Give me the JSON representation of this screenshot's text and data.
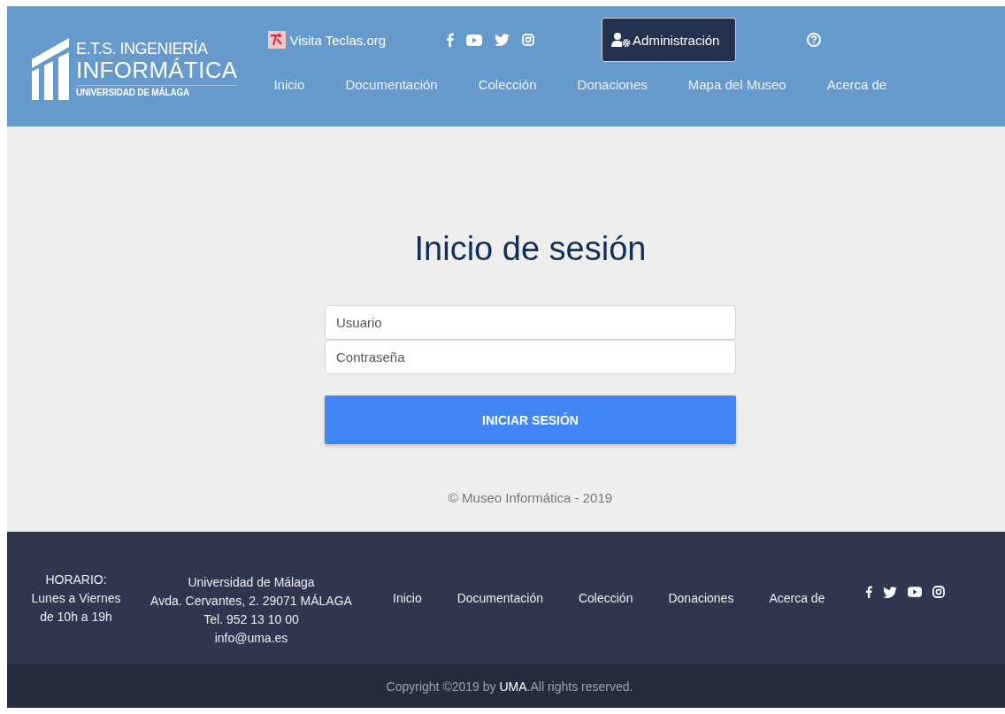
{
  "header": {
    "logo": {
      "line_1": "E.T.S. INGENIERÍA",
      "line_2": "INFORMÁTICA",
      "line_3": "UNIVERSIDAD DE MÁLAGA"
    },
    "teclas_link": "Visita Teclas.org",
    "social": [
      {
        "kind": "facebook"
      },
      {
        "kind": "youtube"
      },
      {
        "kind": "twitter"
      },
      {
        "kind": "instagram"
      }
    ],
    "admin_button": "Administración",
    "nav": [
      "Inicio",
      "Documentación",
      "Colección",
      "Donaciones",
      "Mapa del Museo",
      "Acerca de"
    ]
  },
  "login": {
    "title": "Inicio de sesión",
    "username": {
      "placeholder": "Usuario"
    },
    "password": {
      "placeholder": "Contraseña"
    },
    "submit": "INICIAR SESIÓN",
    "note": "© Museo Informática - 2019"
  },
  "footer": {
    "hours": [
      "HORARIO:",
      "Lunes a Viernes",
      "de 10h a 19h"
    ],
    "address": [
      "Universidad de Málaga",
      "Avda. Cervantes, 2. 29071 MÁLAGA",
      "Tel. 952 13 10 00",
      "info@uma.es"
    ],
    "nav": [
      "Inicio",
      "Documentación",
      "Colección",
      "Donaciones",
      "Acerca de"
    ],
    "social": [
      {
        "kind": "facebook"
      },
      {
        "kind": "twitter"
      },
      {
        "kind": "youtube"
      },
      {
        "kind": "instagram"
      }
    ],
    "copyright": {
      "before": "Copyright ©2019 by",
      "link": "UMA",
      "after": ".All rights reserved."
    }
  }
}
